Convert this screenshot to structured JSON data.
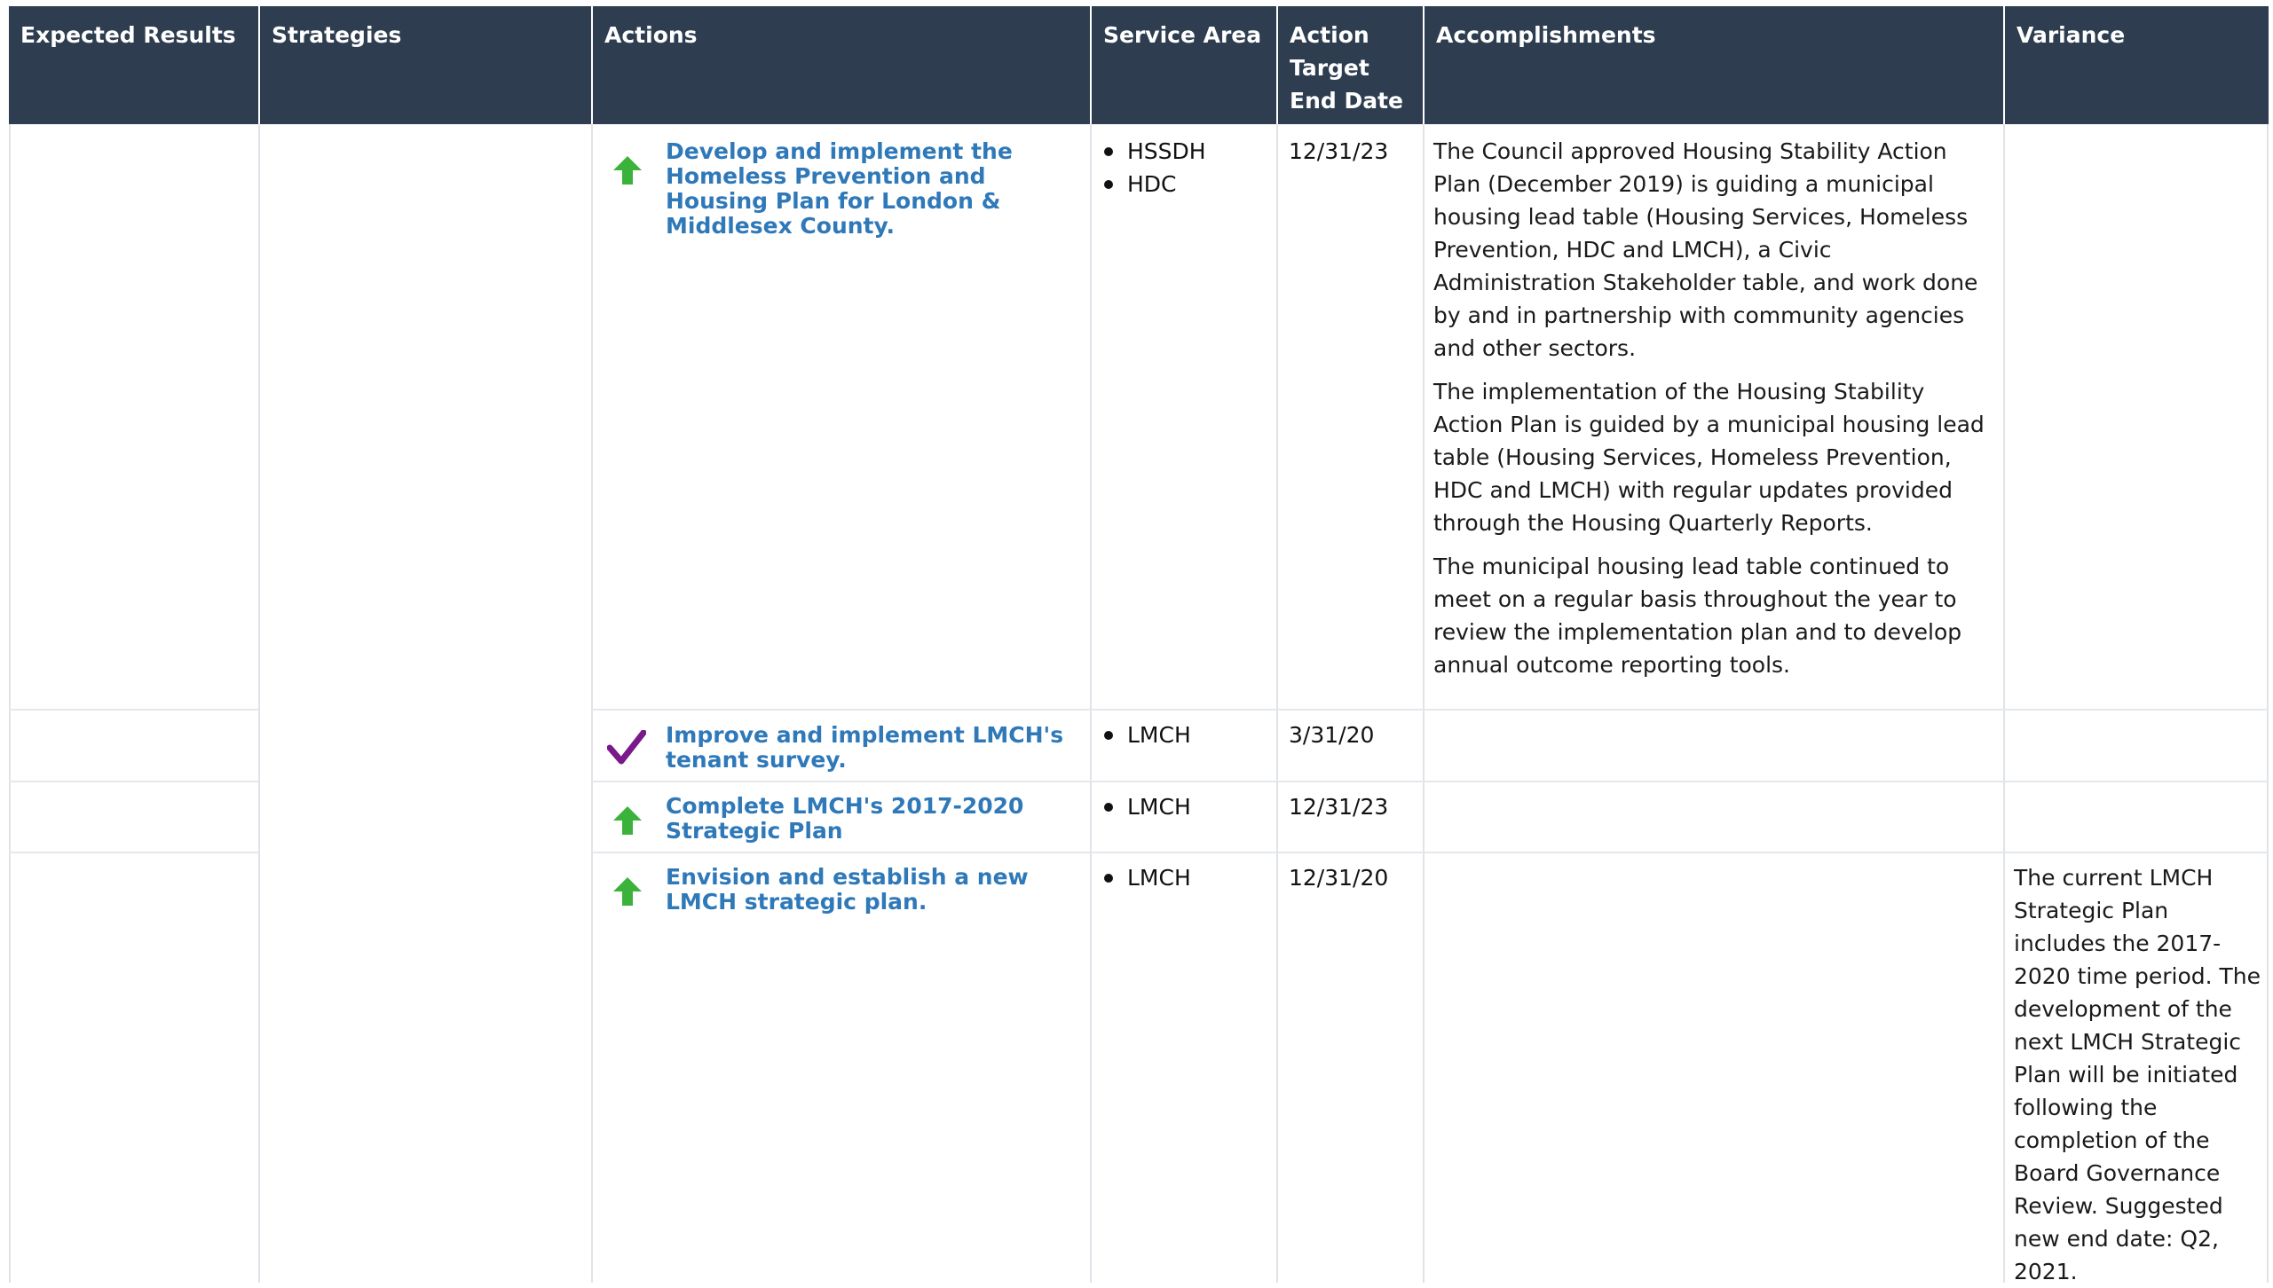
{
  "headers": {
    "expected_results": "Expected Results",
    "strategies": "Strategies",
    "actions": "Actions",
    "service_area": "Service Area",
    "action_target_end_date": "Action Target End Date",
    "accomplishments": "Accomplishments",
    "variance": "Variance"
  },
  "rows": [
    {
      "status_icon": "green-up-arrow-icon",
      "action": "Develop and implement the Homeless Prevention and Housing Plan for London & Middlesex County.",
      "service_area": [
        "HSSDH",
        "HDC"
      ],
      "target_date": "12/31/23",
      "accomplishments": [
        "The Council approved Housing Stability Action Plan (December 2019) is guiding a municipal housing lead table (Housing Services, Homeless Prevention, HDC and LMCH), a Civic Administration Stakeholder table, and work done by and in partnership with community agencies and other sectors.",
        "The implementation of the Housing Stability Action Plan is guided by a municipal housing lead table (Housing Services, Homeless Prevention, HDC and LMCH) with regular updates provided through the Housing Quarterly Reports.",
        "The municipal housing lead table continued to meet on a regular basis throughout the year to review the implementation plan and to develop annual outcome reporting tools."
      ],
      "variance": ""
    },
    {
      "status_icon": "purple-checkmark-icon",
      "action": "Improve and implement LMCH's tenant survey.",
      "service_area": [
        "LMCH"
      ],
      "target_date": "3/31/20",
      "accomplishments": [],
      "variance": ""
    },
    {
      "status_icon": "green-up-arrow-icon",
      "action": "Complete LMCH's 2017-2020 Strategic Plan",
      "service_area": [
        "LMCH"
      ],
      "target_date": "12/31/23",
      "accomplishments": [],
      "variance": ""
    },
    {
      "status_icon": "green-up-arrow-icon",
      "action": "Envision and establish a new LMCH strategic plan.",
      "service_area": [
        "LMCH"
      ],
      "target_date": "12/31/20",
      "accomplishments": [],
      "variance": "The current LMCH Strategic Plan includes the 2017-2020 time period. The development of the next LMCH Strategic Plan will be initiated following the completion of the Board Governance Review.  Suggested new end date: Q2, 2021."
    }
  ],
  "colors": {
    "header_bg": "#2e3e50",
    "action_link": "#2f79b9",
    "arrow_green": "#3bb33b",
    "check_purple": "#7a1a8a",
    "grid_line": "#dfe3e7"
  }
}
